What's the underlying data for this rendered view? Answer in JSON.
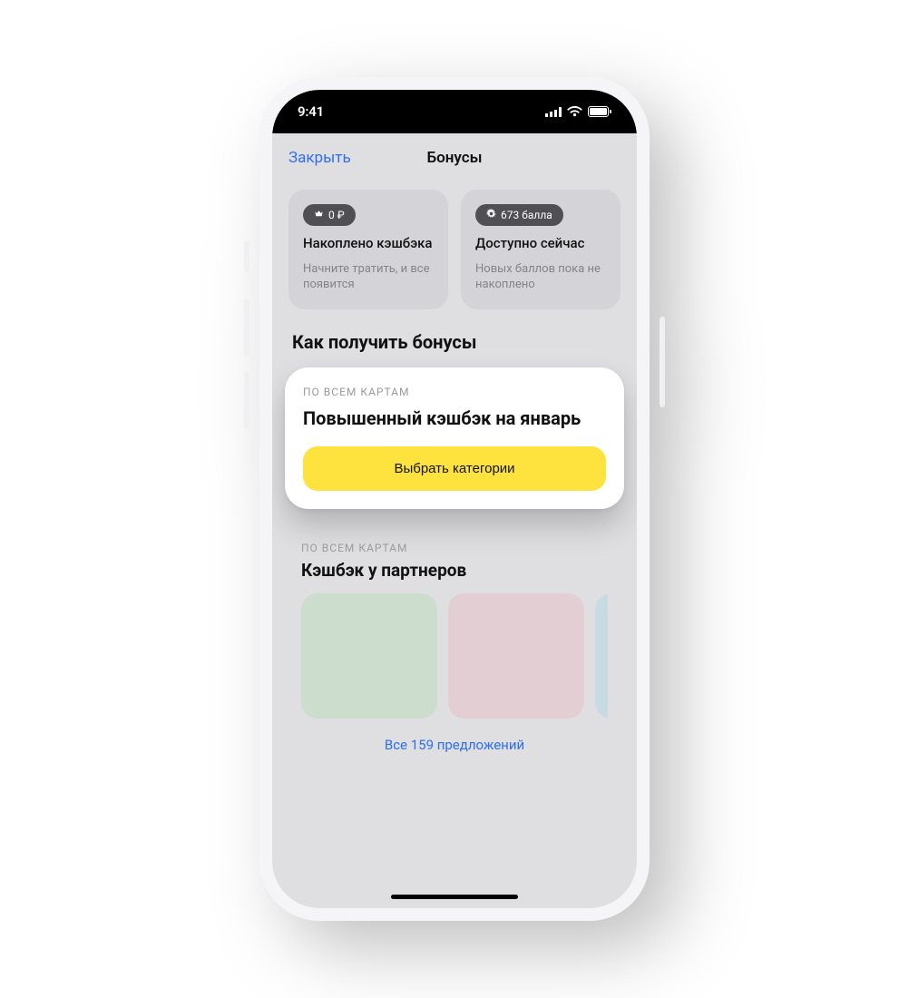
{
  "status": {
    "time": "9:41"
  },
  "nav": {
    "close": "Закрыть",
    "title": "Бонусы"
  },
  "cards": {
    "cashback": {
      "badge": "0 ₽",
      "title": "Накоплено кэшбэка",
      "sub": "Начните тратить, и все появится"
    },
    "points": {
      "badge": "673 балла",
      "title": "Доступно сейчас",
      "sub": "Новых баллов пока не накоплено"
    }
  },
  "section_heading": "Как получить бонусы",
  "promo": {
    "eyebrow": "ПО ВСЕМ КАРТАМ",
    "title": "Повышенный кэшбэк на январь",
    "button": "Выбрать категории"
  },
  "partners": {
    "eyebrow": "ПО ВСЕМ КАРТАМ",
    "title": "Кэшбэк у партнеров",
    "all": "Все 159 предложений"
  },
  "colors": {
    "accent_blue": "#2f6ff0",
    "accent_yellow": "#fee23e"
  }
}
